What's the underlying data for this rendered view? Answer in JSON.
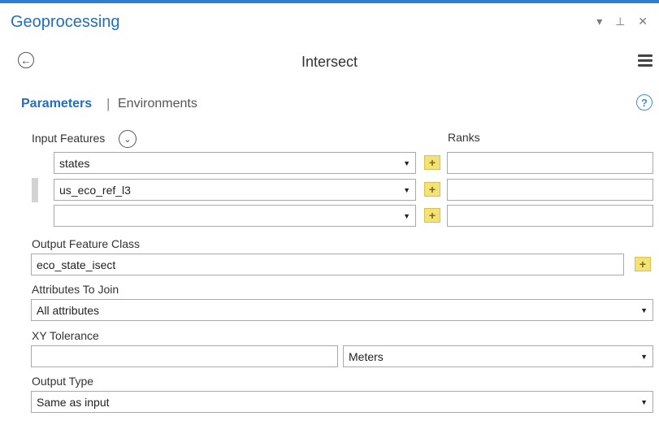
{
  "pane": {
    "title": "Geoprocessing",
    "controls": "▾ ⊥ ✕"
  },
  "tool": {
    "title": "Intersect",
    "back_glyph": "←",
    "menu_icon": "hamburger-icon"
  },
  "tabs": {
    "parameters": "Parameters",
    "separator": "|",
    "environments": "Environments",
    "help_glyph": "?"
  },
  "input_features": {
    "label": "Input Features",
    "expand_glyph": "⌄",
    "ranks_label": "Ranks",
    "rows": [
      {
        "value": "states",
        "rank": ""
      },
      {
        "value": "us_eco_ref_l3",
        "rank": ""
      },
      {
        "value": "",
        "rank": ""
      }
    ]
  },
  "output_feature_class": {
    "label": "Output Feature Class",
    "value": "eco_state_isect"
  },
  "attributes_to_join": {
    "label": "Attributes To Join",
    "value": "All attributes"
  },
  "xy_tolerance": {
    "label": "XY Tolerance",
    "value": "",
    "unit": "Meters"
  },
  "output_type": {
    "label": "Output Type",
    "value": "Same as input"
  },
  "glyphs": {
    "dropdown": "▼",
    "add": "+"
  },
  "colors": {
    "accent": "#1f6fbf",
    "top_bar": "#2e7dd1",
    "add_button": "#f3e27a"
  }
}
